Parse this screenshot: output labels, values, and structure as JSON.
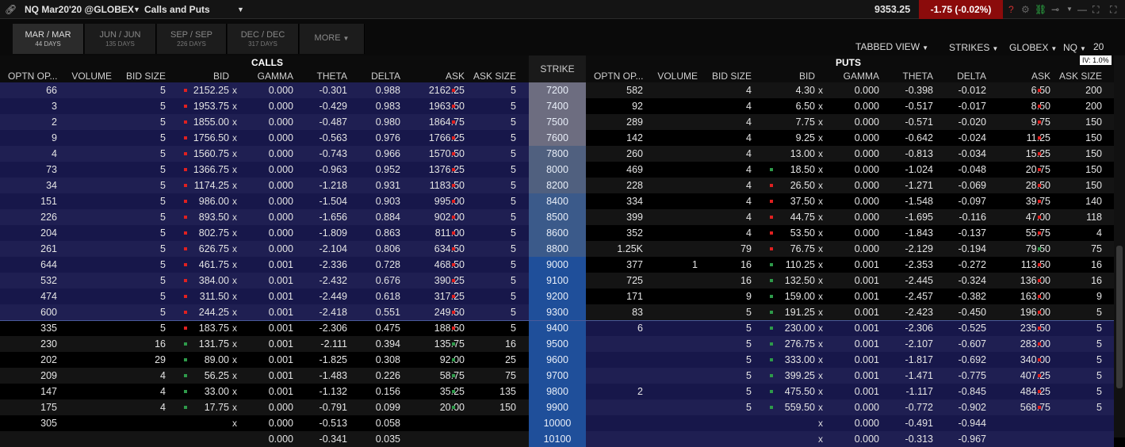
{
  "titlebar": {
    "symbol": "NQ Mar20'20 @GLOBEX",
    "window_title": "Calls and Puts",
    "last_price": "9353.25",
    "change": "-1.75 (-0.02%)"
  },
  "expiries": [
    {
      "label": "MAR / MAR",
      "days": "44 DAYS",
      "active": true
    },
    {
      "label": "JUN / JUN",
      "days": "135 DAYS",
      "active": false
    },
    {
      "label": "SEP / SEP",
      "days": "226 DAYS",
      "active": false
    },
    {
      "label": "DEC / DEC",
      "days": "317 DAYS",
      "active": false
    }
  ],
  "more_label": "MORE",
  "controls": {
    "view": "TABBED VIEW",
    "strikes": "STRIKES",
    "exchange": "GLOBEX",
    "underlying": "NQ",
    "strike_count": "20",
    "iv": "IV: 1.0%"
  },
  "sections": {
    "calls": "CALLS",
    "puts": "PUTS",
    "strike": "STRIKE"
  },
  "columns": [
    "OPTN OP...",
    "VOLUME",
    "BID SIZE",
    "BID",
    "GAMMA",
    "THETA",
    "DELTA",
    "ASK",
    "ASK SIZE"
  ],
  "colors": {
    "itm_even": "#1f1f52",
    "itm_odd": "#17174a",
    "otm_even": "#141414",
    "otm_odd": "#000000",
    "red": "#e02020",
    "green": "#2e9a4a",
    "change_bg": "#8b0b0b"
  },
  "rows": [
    {
      "strike": "7200",
      "call": [
        "66",
        "",
        "5",
        "2152.25",
        "0.000",
        "-0.301",
        "0.988",
        "2162.25",
        "5"
      ],
      "put": [
        "582",
        "",
        "4",
        "4.30",
        "0.000",
        "-0.398",
        "-0.012",
        "6.50",
        "200"
      ],
      "cbd": "r",
      "cad": "r",
      "pbd": "",
      "pad": "r"
    },
    {
      "strike": "7400",
      "call": [
        "3",
        "",
        "5",
        "1953.75",
        "0.000",
        "-0.429",
        "0.983",
        "1963.50",
        "5"
      ],
      "put": [
        "92",
        "",
        "4",
        "6.50",
        "0.000",
        "-0.517",
        "-0.017",
        "8.50",
        "200"
      ],
      "cbd": "r",
      "cad": "r",
      "pbd": "",
      "pad": "r"
    },
    {
      "strike": "7500",
      "call": [
        "2",
        "",
        "5",
        "1855.00",
        "0.000",
        "-0.487",
        "0.980",
        "1864.75",
        "5"
      ],
      "put": [
        "289",
        "",
        "4",
        "7.75",
        "0.000",
        "-0.571",
        "-0.020",
        "9.75",
        "150"
      ],
      "cbd": "r",
      "cad": "r",
      "pbd": "",
      "pad": "r"
    },
    {
      "strike": "7600",
      "call": [
        "9",
        "",
        "5",
        "1756.50",
        "0.000",
        "-0.563",
        "0.976",
        "1766.25",
        "5"
      ],
      "put": [
        "142",
        "",
        "4",
        "9.25",
        "0.000",
        "-0.642",
        "-0.024",
        "11.25",
        "150"
      ],
      "cbd": "r",
      "cad": "r",
      "pbd": "",
      "pad": "r"
    },
    {
      "strike": "7800",
      "call": [
        "4",
        "",
        "5",
        "1560.75",
        "0.000",
        "-0.743",
        "0.966",
        "1570.50",
        "5"
      ],
      "put": [
        "260",
        "",
        "4",
        "13.00",
        "0.000",
        "-0.813",
        "-0.034",
        "15.25",
        "150"
      ],
      "cbd": "r",
      "cad": "r",
      "pbd": "",
      "pad": "r"
    },
    {
      "strike": "8000",
      "call": [
        "73",
        "",
        "5",
        "1366.75",
        "0.000",
        "-0.963",
        "0.952",
        "1376.25",
        "5"
      ],
      "put": [
        "469",
        "",
        "4",
        "18.50",
        "0.000",
        "-1.024",
        "-0.048",
        "20.75",
        "150"
      ],
      "cbd": "r",
      "cad": "r",
      "pbd": "g",
      "pad": "r"
    },
    {
      "strike": "8200",
      "call": [
        "34",
        "",
        "5",
        "1174.25",
        "0.000",
        "-1.218",
        "0.931",
        "1183.50",
        "5"
      ],
      "put": [
        "228",
        "",
        "4",
        "26.50",
        "0.000",
        "-1.271",
        "-0.069",
        "28.50",
        "150"
      ],
      "cbd": "r",
      "cad": "r",
      "pbd": "r",
      "pad": "r"
    },
    {
      "strike": "8400",
      "call": [
        "151",
        "",
        "5",
        "986.00",
        "0.000",
        "-1.504",
        "0.903",
        "995.00",
        "5"
      ],
      "put": [
        "334",
        "",
        "4",
        "37.50",
        "0.000",
        "-1.548",
        "-0.097",
        "39.75",
        "140"
      ],
      "cbd": "r",
      "cad": "r",
      "pbd": "r",
      "pad": "r"
    },
    {
      "strike": "8500",
      "call": [
        "226",
        "",
        "5",
        "893.50",
        "0.000",
        "-1.656",
        "0.884",
        "902.00",
        "5"
      ],
      "put": [
        "399",
        "",
        "4",
        "44.75",
        "0.000",
        "-1.695",
        "-0.116",
        "47.00",
        "118"
      ],
      "cbd": "r",
      "cad": "r",
      "pbd": "r",
      "pad": "r"
    },
    {
      "strike": "8600",
      "call": [
        "204",
        "",
        "5",
        "802.75",
        "0.000",
        "-1.809",
        "0.863",
        "811.00",
        "5"
      ],
      "put": [
        "352",
        "",
        "4",
        "53.50",
        "0.000",
        "-1.843",
        "-0.137",
        "55.75",
        "4"
      ],
      "cbd": "r",
      "cad": "r",
      "pbd": "r",
      "pad": "r"
    },
    {
      "strike": "8800",
      "call": [
        "261",
        "",
        "5",
        "626.75",
        "0.000",
        "-2.104",
        "0.806",
        "634.50",
        "5"
      ],
      "put": [
        "1.25K",
        "",
        "79",
        "76.75",
        "0.000",
        "-2.129",
        "-0.194",
        "79.50",
        "75"
      ],
      "cbd": "r",
      "cad": "r",
      "pbd": "r",
      "pad": "g"
    },
    {
      "strike": "9000",
      "call": [
        "644",
        "",
        "5",
        "461.75",
        "0.001",
        "-2.336",
        "0.728",
        "468.50",
        "5"
      ],
      "put": [
        "377",
        "1",
        "16",
        "110.25",
        "0.001",
        "-2.353",
        "-0.272",
        "113.50",
        "16"
      ],
      "cbd": "r",
      "cad": "r",
      "pbd": "g",
      "pad": "r"
    },
    {
      "strike": "9100",
      "call": [
        "532",
        "",
        "5",
        "384.00",
        "0.001",
        "-2.432",
        "0.676",
        "390.25",
        "5"
      ],
      "put": [
        "725",
        "",
        "16",
        "132.50",
        "0.001",
        "-2.445",
        "-0.324",
        "136.00",
        "16"
      ],
      "cbd": "r",
      "cad": "r",
      "pbd": "g",
      "pad": "r"
    },
    {
      "strike": "9200",
      "call": [
        "474",
        "",
        "5",
        "311.50",
        "0.001",
        "-2.449",
        "0.618",
        "317.25",
        "5"
      ],
      "put": [
        "171",
        "",
        "9",
        "159.00",
        "0.001",
        "-2.457",
        "-0.382",
        "163.00",
        "9"
      ],
      "cbd": "r",
      "cad": "r",
      "pbd": "g",
      "pad": "r"
    },
    {
      "strike": "9300",
      "call": [
        "600",
        "",
        "5",
        "244.25",
        "0.001",
        "-2.418",
        "0.551",
        "249.50",
        "5"
      ],
      "put": [
        "83",
        "",
        "5",
        "191.25",
        "0.001",
        "-2.423",
        "-0.450",
        "196.00",
        "5"
      ],
      "cbd": "r",
      "cad": "r",
      "pbd": "g",
      "pad": "r"
    },
    {
      "strike": "9400",
      "call": [
        "335",
        "",
        "5",
        "183.75",
        "0.001",
        "-2.306",
        "0.475",
        "188.50",
        "5"
      ],
      "put": [
        "6",
        "",
        "5",
        "230.00",
        "0.001",
        "-2.306",
        "-0.525",
        "235.50",
        "5"
      ],
      "cbd": "r",
      "cad": "r",
      "pbd": "g",
      "pad": "r"
    },
    {
      "strike": "9500",
      "call": [
        "230",
        "",
        "16",
        "131.75",
        "0.001",
        "-2.111",
        "0.394",
        "135.75",
        "16"
      ],
      "put": [
        "",
        "",
        "5",
        "276.75",
        "0.001",
        "-2.107",
        "-0.607",
        "283.00",
        "5"
      ],
      "cbd": "g",
      "cad": "g",
      "pbd": "g",
      "pad": "r"
    },
    {
      "strike": "9600",
      "call": [
        "202",
        "",
        "29",
        "89.00",
        "0.001",
        "-1.825",
        "0.308",
        "92.00",
        "25"
      ],
      "put": [
        "",
        "",
        "5",
        "333.00",
        "0.001",
        "-1.817",
        "-0.692",
        "340.00",
        "5"
      ],
      "cbd": "g",
      "cad": "g",
      "pbd": "g",
      "pad": "r"
    },
    {
      "strike": "9700",
      "call": [
        "209",
        "",
        "4",
        "56.25",
        "0.001",
        "-1.483",
        "0.226",
        "58.75",
        "75"
      ],
      "put": [
        "",
        "",
        "5",
        "399.25",
        "0.001",
        "-1.471",
        "-0.775",
        "407.25",
        "5"
      ],
      "cbd": "g",
      "cad": "g",
      "pbd": "g",
      "pad": "r"
    },
    {
      "strike": "9800",
      "call": [
        "147",
        "",
        "4",
        "33.00",
        "0.001",
        "-1.132",
        "0.156",
        "35.25",
        "135"
      ],
      "put": [
        "2",
        "",
        "5",
        "475.50",
        "0.001",
        "-1.117",
        "-0.845",
        "484.25",
        "5"
      ],
      "cbd": "g",
      "cad": "g",
      "pbd": "g",
      "pad": "r"
    },
    {
      "strike": "9900",
      "call": [
        "175",
        "",
        "4",
        "17.75",
        "0.000",
        "-0.791",
        "0.099",
        "20.00",
        "150"
      ],
      "put": [
        "",
        "",
        "5",
        "559.50",
        "0.000",
        "-0.772",
        "-0.902",
        "568.75",
        "5"
      ],
      "cbd": "g",
      "cad": "g",
      "pbd": "g",
      "pad": "r"
    },
    {
      "strike": "10000",
      "call": [
        "305",
        "",
        "",
        "",
        "0.000",
        "-0.513",
        "0.058",
        "",
        ""
      ],
      "put": [
        "",
        "",
        "",
        "",
        "0.000",
        "-0.491",
        "-0.944",
        "",
        ""
      ],
      "cbd": "",
      "cad": "",
      "pbd": "",
      "pad": ""
    },
    {
      "strike": "10100",
      "call": [
        "",
        "",
        "",
        "",
        "0.000",
        "-0.341",
        "0.035",
        "",
        ""
      ],
      "put": [
        "",
        "",
        "",
        "",
        "0.000",
        "-0.313",
        "-0.967",
        "",
        ""
      ],
      "cbd": "",
      "cad": "",
      "pbd": "",
      "pad": ""
    }
  ]
}
